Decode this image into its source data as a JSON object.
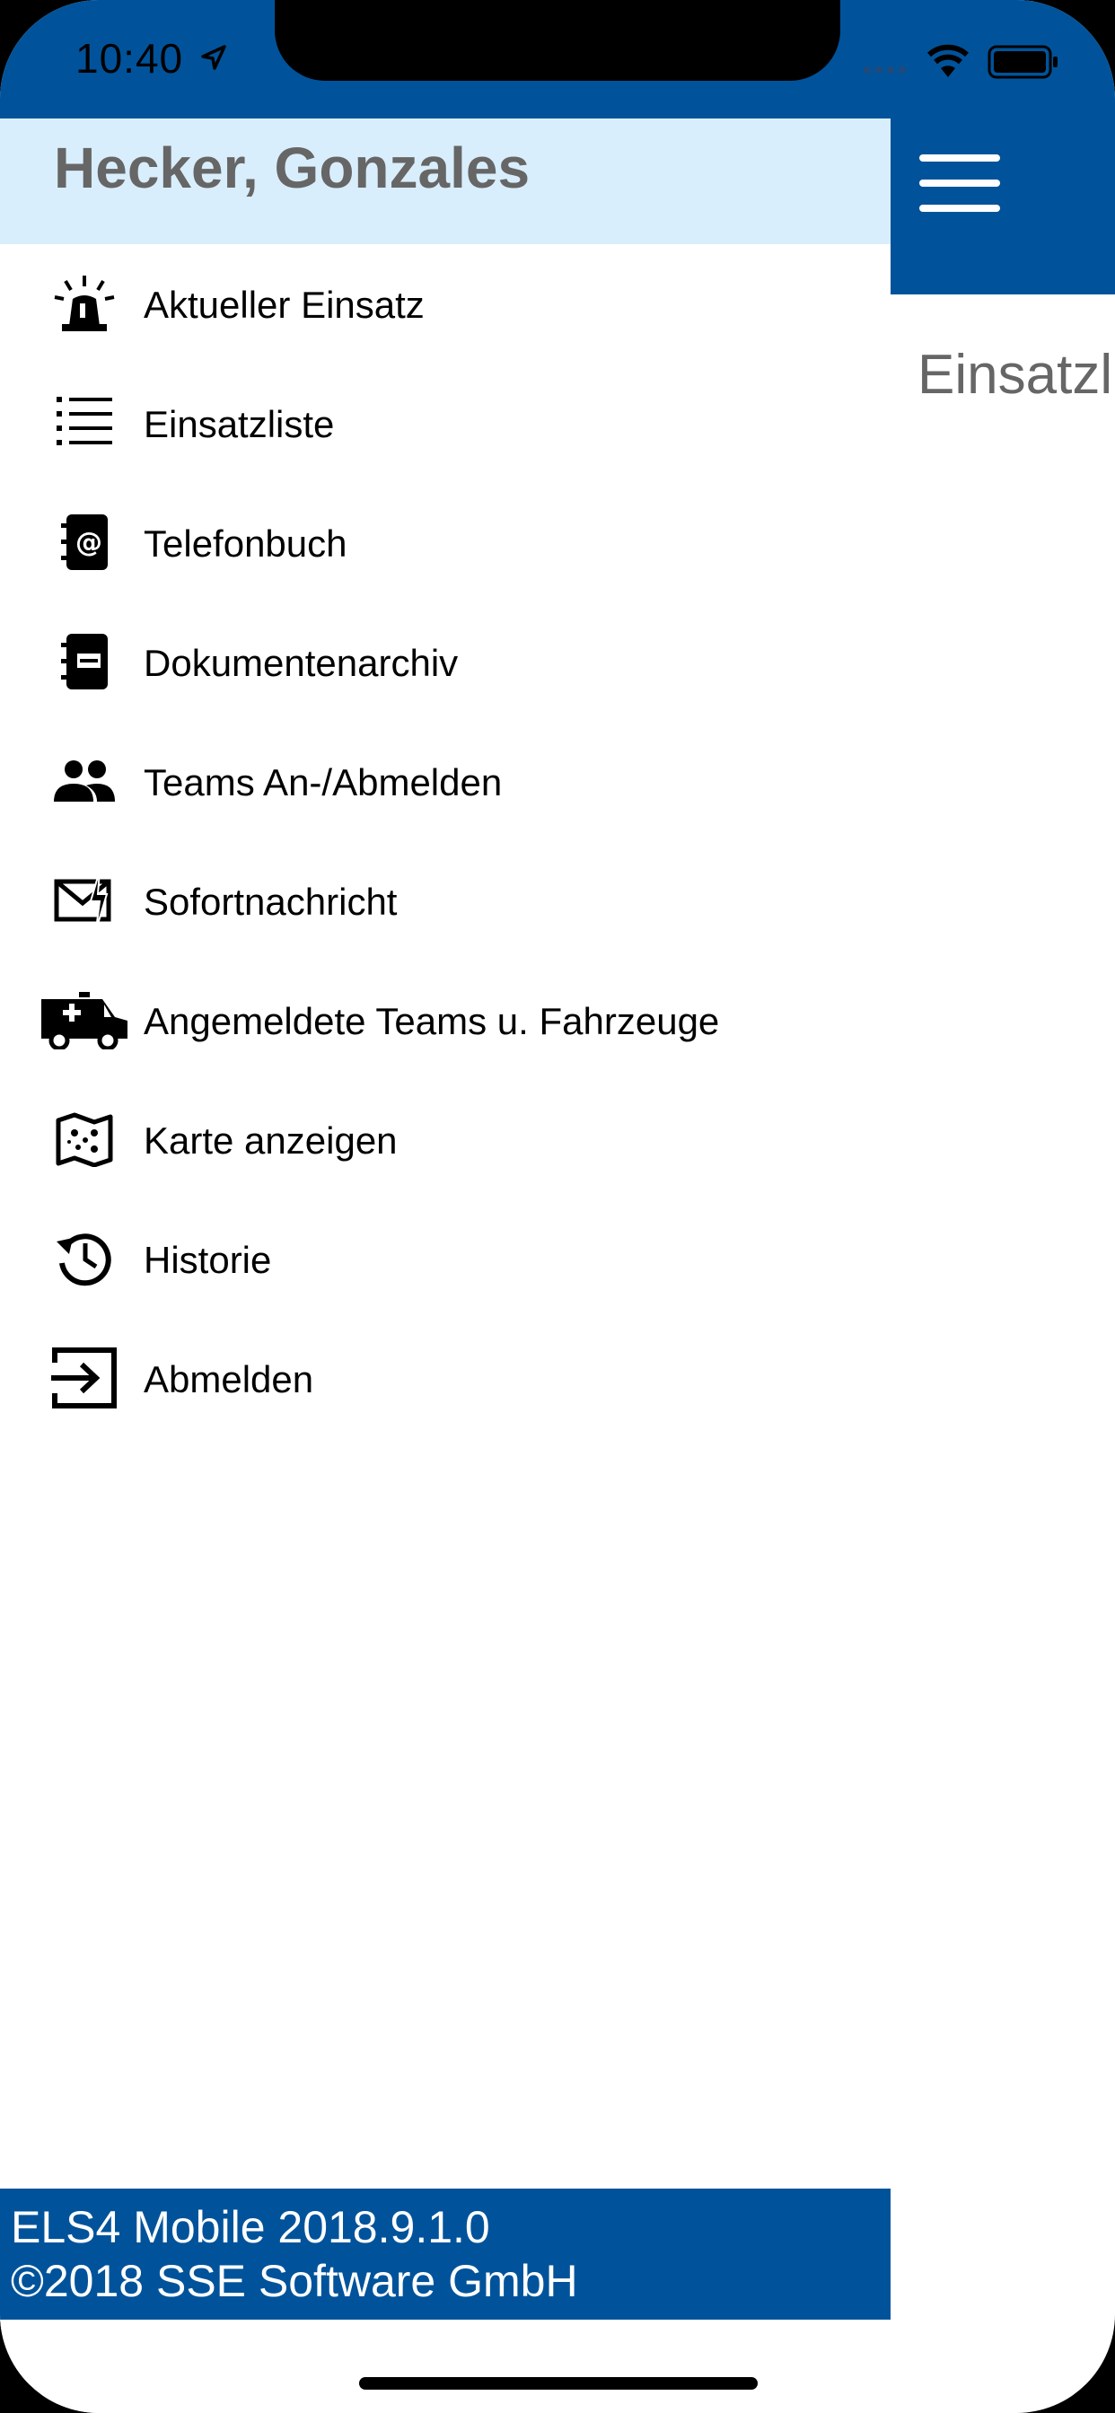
{
  "status_bar": {
    "time": "10:40"
  },
  "background_app": {
    "title": "Einsatzl"
  },
  "drawer": {
    "user_name": "Hecker, Gonzales",
    "items": [
      {
        "label": "Aktueller Einsatz",
        "icon": "siren-icon"
      },
      {
        "label": "Einsatzliste",
        "icon": "list-icon"
      },
      {
        "label": "Telefonbuch",
        "icon": "phonebook-icon"
      },
      {
        "label": "Dokumentenarchiv",
        "icon": "document-archive-icon"
      },
      {
        "label": "Teams An-/Abmelden",
        "icon": "teams-icon"
      },
      {
        "label": "Sofortnachricht",
        "icon": "instant-message-icon"
      },
      {
        "label": "Angemeldete Teams u. Fahrzeuge",
        "icon": "ambulance-icon"
      },
      {
        "label": "Karte anzeigen",
        "icon": "map-icon"
      },
      {
        "label": "Historie",
        "icon": "history-icon"
      },
      {
        "label": "Abmelden",
        "icon": "logout-icon"
      }
    ],
    "footer": {
      "version": "ELS4 Mobile 2018.9.1.0",
      "copyright": "©2018 SSE Software GmbH"
    }
  },
  "colors": {
    "brand_blue": "#00539b",
    "drawer_header_bg": "#d9eefc"
  }
}
